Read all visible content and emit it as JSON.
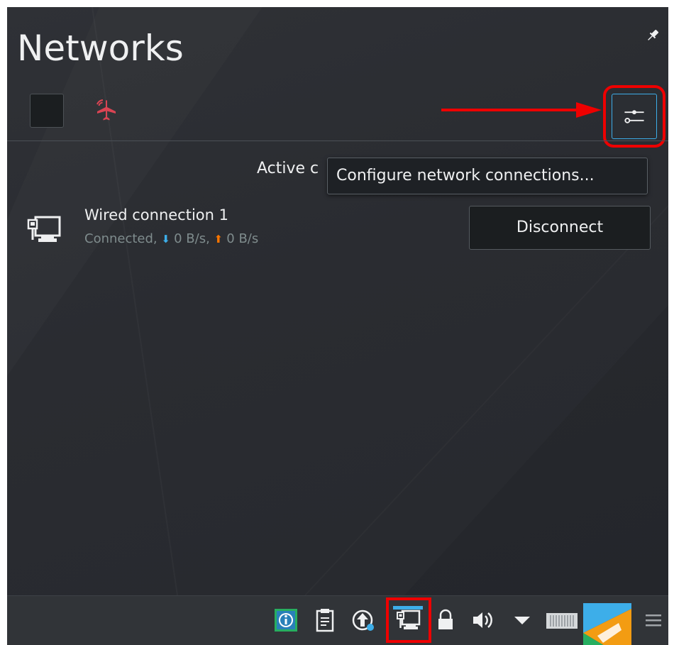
{
  "popup": {
    "title": "Networks",
    "pin_icon": "pin-icon"
  },
  "toolbar": {
    "wifi_toggle_icon": "checkbox",
    "airplane_icon": "airplane-mode-icon",
    "configure_icon": "sliders-icon"
  },
  "tooltip": {
    "text": "Configure network connections..."
  },
  "section": {
    "heading": "Active c"
  },
  "connection": {
    "name": "Wired connection 1",
    "status": "Connected,",
    "down_arrow": "⬇",
    "down_rate": "0 B/s,",
    "up_arrow": "⬆",
    "up_rate": "0 B/s",
    "icon": "wired-network-icon",
    "action_label": "Disconnect"
  },
  "taskbar": {
    "items": [
      {
        "name": "info-center-icon"
      },
      {
        "name": "clipboard-icon"
      },
      {
        "name": "update-notifier-icon"
      },
      {
        "name": "network-icon",
        "active": true
      },
      {
        "name": "lock-icon"
      },
      {
        "name": "volume-icon"
      },
      {
        "name": "expand-tray-arrow-icon"
      },
      {
        "name": "pager-icon"
      },
      {
        "name": "application-launcher-icon"
      },
      {
        "name": "panel-menu-icon"
      }
    ]
  },
  "colors": {
    "panel_bg": "#2a2c31",
    "text": "#eff0f1",
    "muted_text": "#7f8c8d",
    "accent": "#3daee9",
    "airplane": "#da4453",
    "down_arrow": "#3daee9",
    "up_arrow": "#f67400",
    "annotation": "#ee0000"
  }
}
